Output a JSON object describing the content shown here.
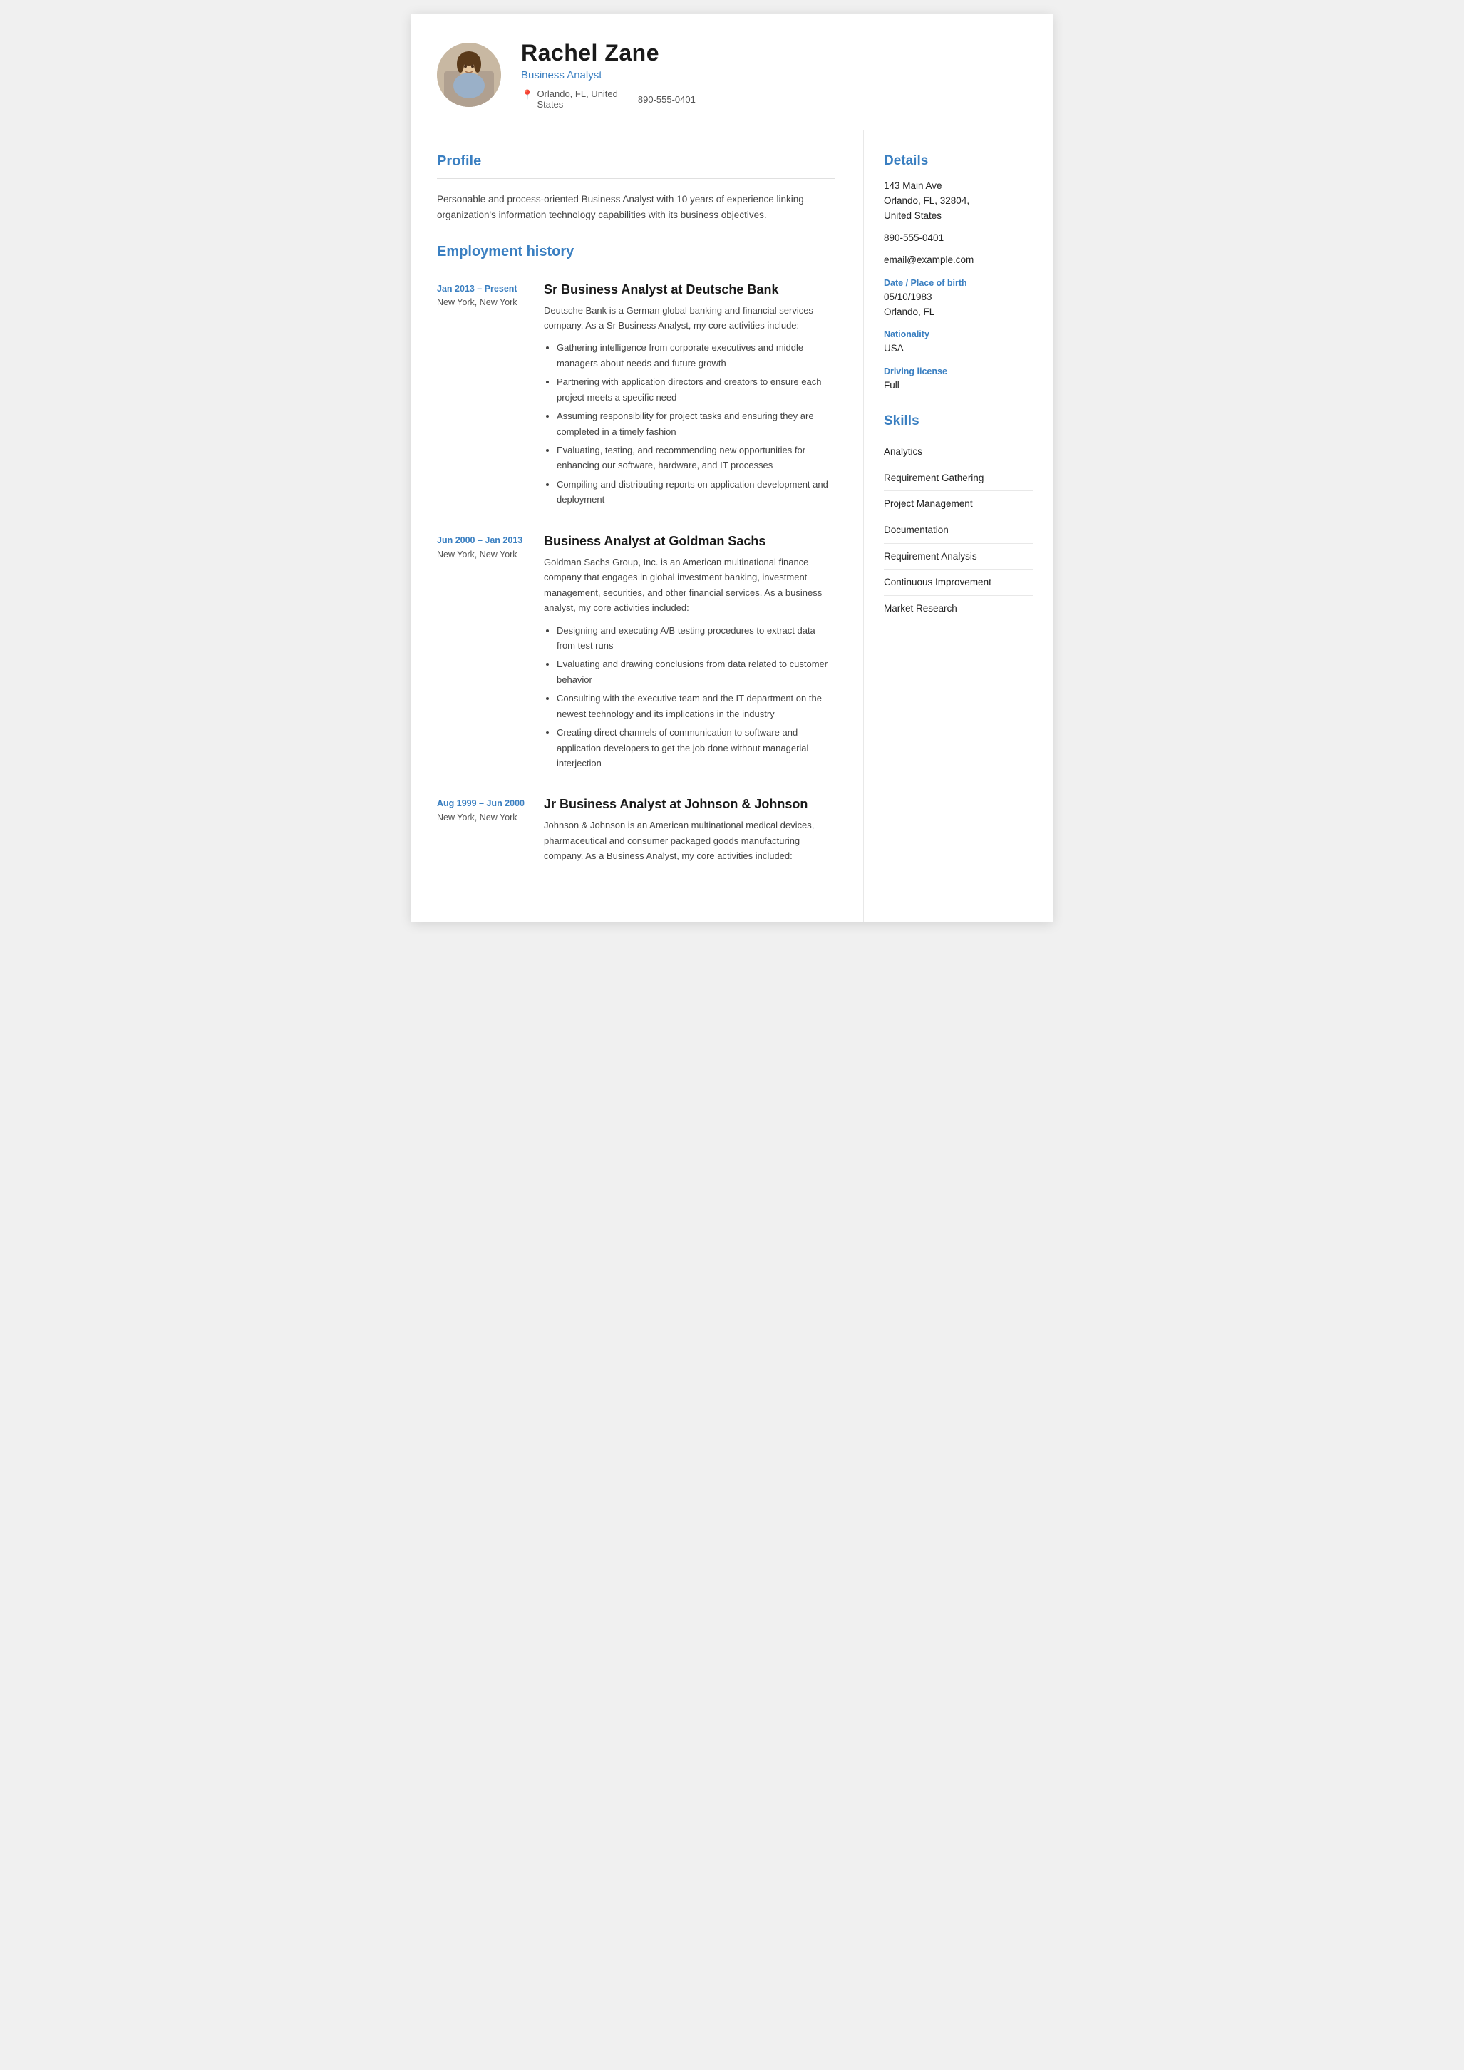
{
  "header": {
    "name": "Rachel Zane",
    "title": "Business Analyst",
    "location_line1": "Orlando, FL, United",
    "location_line2": "States",
    "phone": "890-555-0401"
  },
  "profile": {
    "section_label": "Profile",
    "text": "Personable and process-oriented Business Analyst with 10 years of experience linking organization's information technology capabilities with its business objectives."
  },
  "employment": {
    "section_label": "Employment history",
    "entries": [
      {
        "date": "Jan 2013 – Present",
        "location": "New York, New York",
        "job_title": "Sr Business Analyst at Deutsche Bank",
        "description": "Deutsche Bank is a German global banking and financial services company. As a Sr Business Analyst, my core activities include:",
        "bullets": [
          "Gathering intelligence from corporate executives and middle managers about needs and future growth",
          "Partnering with application directors and creators to ensure each project meets a specific need",
          "Assuming responsibility for project tasks and ensuring they are completed in a timely fashion",
          "Evaluating, testing, and recommending new opportunities for enhancing our software, hardware, and IT processes",
          "Compiling and distributing reports on application development and deployment"
        ]
      },
      {
        "date": "Jun 2000 – Jan 2013",
        "location": "New York, New York",
        "job_title": "Business Analyst at Goldman Sachs",
        "description": "Goldman Sachs Group, Inc. is an American multinational finance company that engages in global investment banking, investment management, securities, and other financial services. As a business analyst, my core activities included:",
        "bullets": [
          "Designing and executing A/B testing procedures to extract data from test runs",
          "Evaluating and drawing conclusions from data related to customer behavior",
          "Consulting with the executive team and the IT department on the newest technology and its implications in the industry",
          "Creating direct channels of communication to software and application developers to get the job done without managerial interjection"
        ]
      },
      {
        "date": "Aug 1999 – Jun 2000",
        "location": "New York, New York",
        "job_title": "Jr Business Analyst at Johnson & Johnson",
        "description": "Johnson & Johnson is an American multinational medical devices, pharmaceutical and consumer packaged goods manufacturing company. As a Business Analyst, my core activities included:",
        "bullets": []
      }
    ]
  },
  "sidebar": {
    "details_label": "Details",
    "address": "143 Main Ave",
    "city_state_zip": "Orlando, FL, 32804,\nUnited States",
    "phone": "890-555-0401",
    "email": "email@example.com",
    "dob_label": "Date / Place of birth",
    "dob": "05/10/1983",
    "place_of_birth": "Orlando, FL",
    "nationality_label": "Nationality",
    "nationality": "USA",
    "driving_label": "Driving license",
    "driving": "Full",
    "skills_label": "Skills",
    "skills": [
      "Analytics",
      "Requirement Gathering",
      "Project Management",
      "Documentation",
      "Requirement Analysis",
      "Continuous Improvement",
      "Market Research"
    ]
  }
}
